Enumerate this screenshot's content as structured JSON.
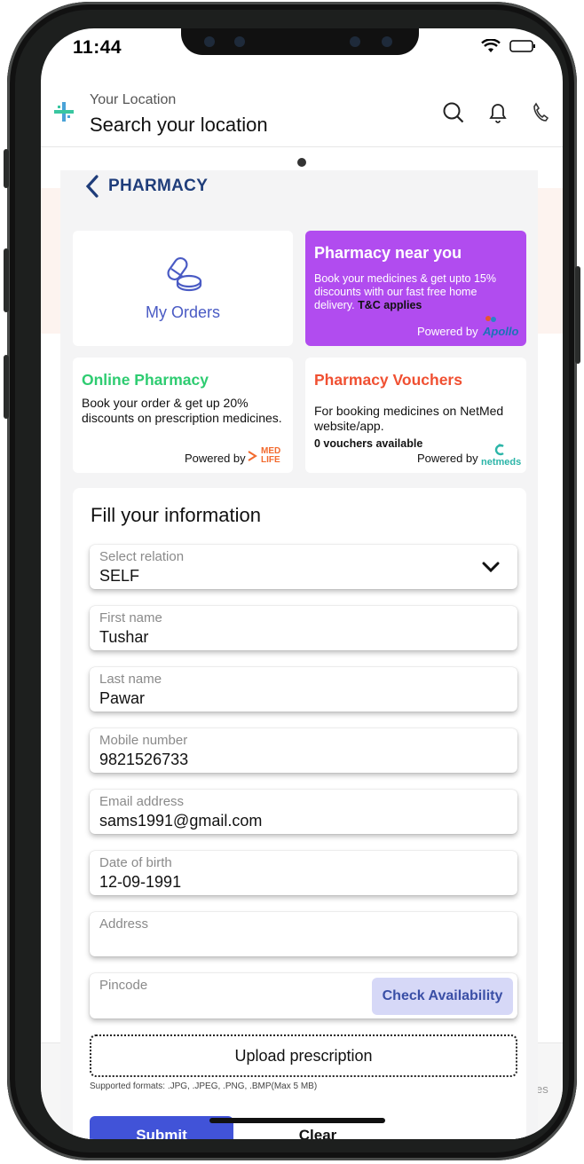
{
  "status_bar": {
    "time": "11:44"
  },
  "header": {
    "location_label": "Your Location",
    "location_value": "Search your location"
  },
  "page": {
    "title": "PHARMACY"
  },
  "cards": {
    "my_orders": {
      "label": "My Orders"
    },
    "pharmacy_near": {
      "title": "Pharmacy near you",
      "text": "Book your medicines & get upto 15% discounts with our fast free home delivery.",
      "tc": "T&C applies",
      "powered_by": "Powered by",
      "brand": "Apollo"
    },
    "online_pharmacy": {
      "title": "Online Pharmacy",
      "text": "Book your order & get up 20% discounts on prescription medicines.",
      "powered_by": "Powered by",
      "brand_top": "MED",
      "brand_bottom": "LIFE"
    },
    "vouchers": {
      "title": "Pharmacy Vouchers",
      "text": "For booking medicines on NetMed website/app.",
      "count": "0 vouchers available",
      "powered_by": "Powered by",
      "brand": "netmeds"
    }
  },
  "form": {
    "title": "Fill your information",
    "fields": [
      {
        "label": "Select relation",
        "value": "SELF"
      },
      {
        "label": "First name",
        "value": "Tushar"
      },
      {
        "label": "Last name",
        "value": "Pawar"
      },
      {
        "label": "Mobile number",
        "value": "9821526733"
      },
      {
        "label": "Email address",
        "value": "sams1991@gmail.com"
      },
      {
        "label": "Date of birth",
        "value": "12-09-1991"
      },
      {
        "label": "Address",
        "value": ""
      },
      {
        "label": "Pincode",
        "value": ""
      }
    ],
    "check_availability": "Check Availability",
    "upload": "Upload prescription",
    "formats": "Supported formats: .JPG, .JPEG, .PNG, .BMP(Max 5 MB)",
    "submit": "Submit",
    "clear": "Clear"
  },
  "side_fragment": "es",
  "colors": {
    "accent": "#4153d8",
    "purple_card": "#b14cef",
    "online_green": "#2ecc71",
    "voucher_red": "#f05032",
    "navy": "#1f3d7a"
  }
}
